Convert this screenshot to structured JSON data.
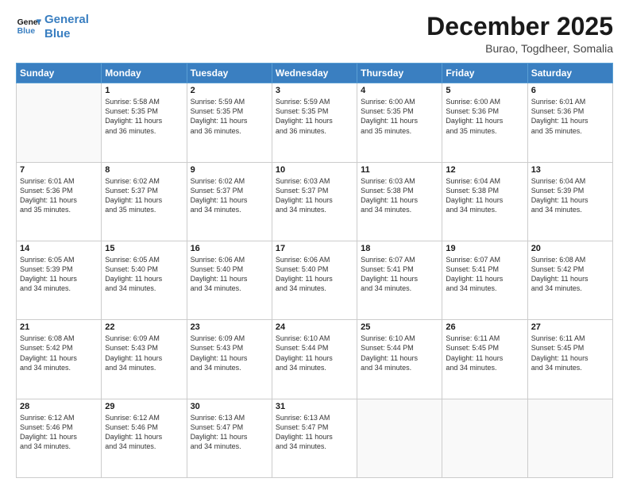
{
  "logo": {
    "line1": "General",
    "line2": "Blue"
  },
  "title": "December 2025",
  "subtitle": "Burao, Togdheer, Somalia",
  "days_of_week": [
    "Sunday",
    "Monday",
    "Tuesday",
    "Wednesday",
    "Thursday",
    "Friday",
    "Saturday"
  ],
  "weeks": [
    [
      {
        "day": "",
        "info": ""
      },
      {
        "day": "1",
        "info": "Sunrise: 5:58 AM\nSunset: 5:35 PM\nDaylight: 11 hours\nand 36 minutes."
      },
      {
        "day": "2",
        "info": "Sunrise: 5:59 AM\nSunset: 5:35 PM\nDaylight: 11 hours\nand 36 minutes."
      },
      {
        "day": "3",
        "info": "Sunrise: 5:59 AM\nSunset: 5:35 PM\nDaylight: 11 hours\nand 36 minutes."
      },
      {
        "day": "4",
        "info": "Sunrise: 6:00 AM\nSunset: 5:35 PM\nDaylight: 11 hours\nand 35 minutes."
      },
      {
        "day": "5",
        "info": "Sunrise: 6:00 AM\nSunset: 5:36 PM\nDaylight: 11 hours\nand 35 minutes."
      },
      {
        "day": "6",
        "info": "Sunrise: 6:01 AM\nSunset: 5:36 PM\nDaylight: 11 hours\nand 35 minutes."
      }
    ],
    [
      {
        "day": "7",
        "info": "Sunrise: 6:01 AM\nSunset: 5:36 PM\nDaylight: 11 hours\nand 35 minutes."
      },
      {
        "day": "8",
        "info": "Sunrise: 6:02 AM\nSunset: 5:37 PM\nDaylight: 11 hours\nand 35 minutes."
      },
      {
        "day": "9",
        "info": "Sunrise: 6:02 AM\nSunset: 5:37 PM\nDaylight: 11 hours\nand 34 minutes."
      },
      {
        "day": "10",
        "info": "Sunrise: 6:03 AM\nSunset: 5:37 PM\nDaylight: 11 hours\nand 34 minutes."
      },
      {
        "day": "11",
        "info": "Sunrise: 6:03 AM\nSunset: 5:38 PM\nDaylight: 11 hours\nand 34 minutes."
      },
      {
        "day": "12",
        "info": "Sunrise: 6:04 AM\nSunset: 5:38 PM\nDaylight: 11 hours\nand 34 minutes."
      },
      {
        "day": "13",
        "info": "Sunrise: 6:04 AM\nSunset: 5:39 PM\nDaylight: 11 hours\nand 34 minutes."
      }
    ],
    [
      {
        "day": "14",
        "info": "Sunrise: 6:05 AM\nSunset: 5:39 PM\nDaylight: 11 hours\nand 34 minutes."
      },
      {
        "day": "15",
        "info": "Sunrise: 6:05 AM\nSunset: 5:40 PM\nDaylight: 11 hours\nand 34 minutes."
      },
      {
        "day": "16",
        "info": "Sunrise: 6:06 AM\nSunset: 5:40 PM\nDaylight: 11 hours\nand 34 minutes."
      },
      {
        "day": "17",
        "info": "Sunrise: 6:06 AM\nSunset: 5:40 PM\nDaylight: 11 hours\nand 34 minutes."
      },
      {
        "day": "18",
        "info": "Sunrise: 6:07 AM\nSunset: 5:41 PM\nDaylight: 11 hours\nand 34 minutes."
      },
      {
        "day": "19",
        "info": "Sunrise: 6:07 AM\nSunset: 5:41 PM\nDaylight: 11 hours\nand 34 minutes."
      },
      {
        "day": "20",
        "info": "Sunrise: 6:08 AM\nSunset: 5:42 PM\nDaylight: 11 hours\nand 34 minutes."
      }
    ],
    [
      {
        "day": "21",
        "info": "Sunrise: 6:08 AM\nSunset: 5:42 PM\nDaylight: 11 hours\nand 34 minutes."
      },
      {
        "day": "22",
        "info": "Sunrise: 6:09 AM\nSunset: 5:43 PM\nDaylight: 11 hours\nand 34 minutes."
      },
      {
        "day": "23",
        "info": "Sunrise: 6:09 AM\nSunset: 5:43 PM\nDaylight: 11 hours\nand 34 minutes."
      },
      {
        "day": "24",
        "info": "Sunrise: 6:10 AM\nSunset: 5:44 PM\nDaylight: 11 hours\nand 34 minutes."
      },
      {
        "day": "25",
        "info": "Sunrise: 6:10 AM\nSunset: 5:44 PM\nDaylight: 11 hours\nand 34 minutes."
      },
      {
        "day": "26",
        "info": "Sunrise: 6:11 AM\nSunset: 5:45 PM\nDaylight: 11 hours\nand 34 minutes."
      },
      {
        "day": "27",
        "info": "Sunrise: 6:11 AM\nSunset: 5:45 PM\nDaylight: 11 hours\nand 34 minutes."
      }
    ],
    [
      {
        "day": "28",
        "info": "Sunrise: 6:12 AM\nSunset: 5:46 PM\nDaylight: 11 hours\nand 34 minutes."
      },
      {
        "day": "29",
        "info": "Sunrise: 6:12 AM\nSunset: 5:46 PM\nDaylight: 11 hours\nand 34 minutes."
      },
      {
        "day": "30",
        "info": "Sunrise: 6:13 AM\nSunset: 5:47 PM\nDaylight: 11 hours\nand 34 minutes."
      },
      {
        "day": "31",
        "info": "Sunrise: 6:13 AM\nSunset: 5:47 PM\nDaylight: 11 hours\nand 34 minutes."
      },
      {
        "day": "",
        "info": ""
      },
      {
        "day": "",
        "info": ""
      },
      {
        "day": "",
        "info": ""
      }
    ]
  ]
}
